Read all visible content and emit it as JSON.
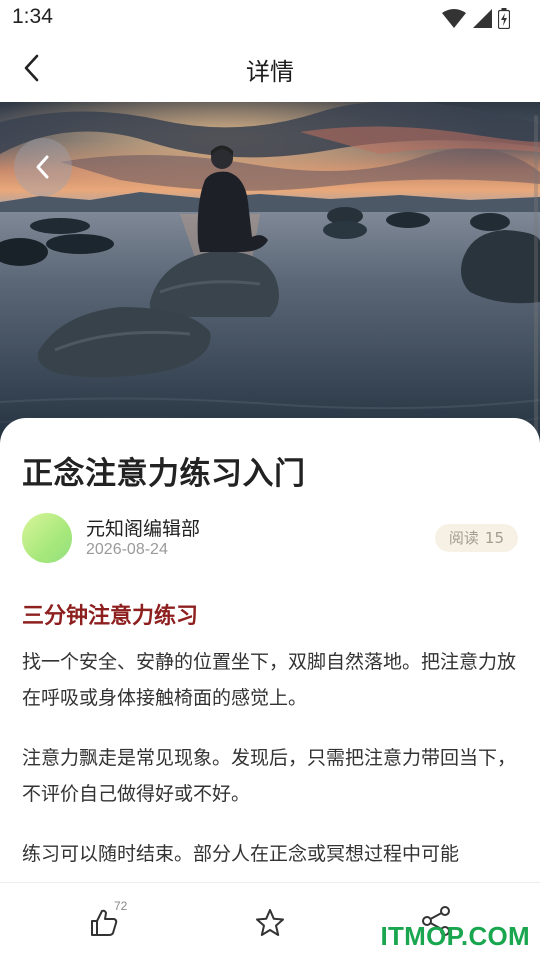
{
  "status_bar": {
    "time": "1:34"
  },
  "header": {
    "title": "详情"
  },
  "article": {
    "title": "正念注意力练习入门",
    "author": "元知阁编辑部",
    "date": "2026-08-24",
    "read_label": "阅读",
    "read_count": "15",
    "section_heading": "三分钟注意力练习",
    "paragraphs": [
      "找一个安全、安静的位置坐下，双脚自然落地。把注意力放在呼吸或身体接触椅面的感觉上。",
      "注意力飘走是常见现象。发现后，只需把注意力带回当下，不评价自己做得好或不好。",
      "练习可以随时结束。部分人在正念或冥想过程中可能"
    ]
  },
  "bottom_bar": {
    "like_count": "72"
  },
  "watermark": "ITMOP.COM",
  "colors": {
    "heading_accent": "#8e1f1f",
    "badge_bg": "#f6f1e4",
    "watermark": "#1aa64f"
  },
  "icons": [
    "wifi-icon",
    "cellular-icon",
    "battery-icon",
    "back-arrow-icon",
    "thumbs-up-icon",
    "star-icon",
    "share-icon"
  ]
}
